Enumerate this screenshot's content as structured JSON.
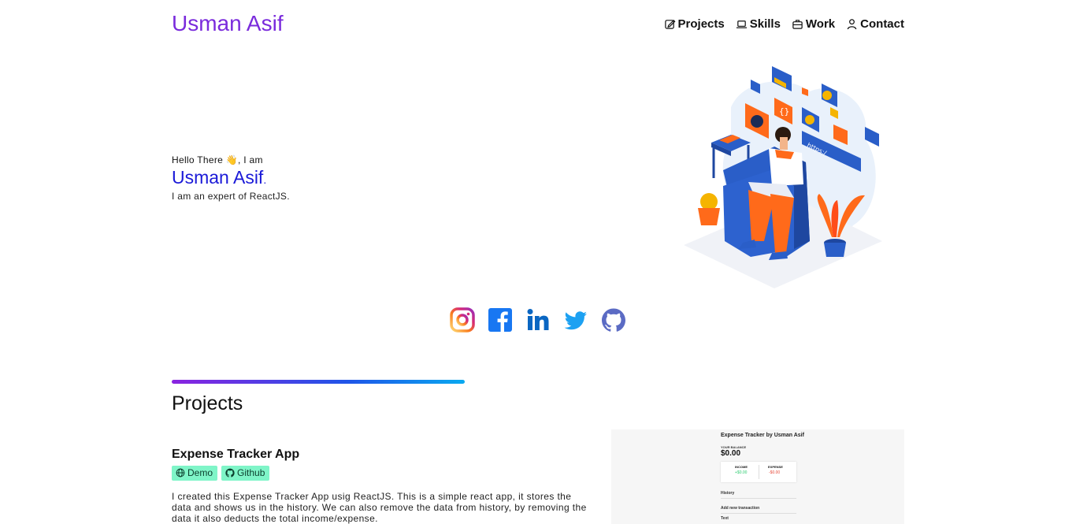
{
  "header": {
    "brand": "Usman Asif",
    "nav": [
      {
        "label": "Projects",
        "icon": "pencil-square-icon"
      },
      {
        "label": "Skills",
        "icon": "laptop-icon"
      },
      {
        "label": "Work",
        "icon": "briefcase-icon"
      },
      {
        "label": "Contact",
        "icon": "person-icon"
      }
    ]
  },
  "hero": {
    "greeting": "Hello There 👋, I am",
    "name": "Usman Asif",
    "name_suffix": ".",
    "tagline": "I am an expert of ReactJS."
  },
  "socials": [
    {
      "name": "instagram",
      "icon": "instagram-icon"
    },
    {
      "name": "facebook",
      "icon": "facebook-icon"
    },
    {
      "name": "linkedin",
      "icon": "linkedin-icon"
    },
    {
      "name": "twitter",
      "icon": "twitter-icon"
    },
    {
      "name": "github",
      "icon": "github-icon"
    }
  ],
  "projects": {
    "title": "Projects",
    "items": [
      {
        "title": "Expense Tracker App",
        "demo_label": "Demo",
        "github_label": "Github",
        "description": "I created this Expense Tracker App usig ReactJS. This is a simple react app, it stores the data and shows us in the history. We can also remove the data from history, by removing the data it also deducts the total income/expense.",
        "preview": {
          "title": "Expense Tracker by Usman Asif",
          "balance_label": "YOUR BALANCE",
          "balance_value": "$0.00",
          "income_label": "INCOME",
          "income_value": "+$0.00",
          "expense_label": "EXPENSE",
          "expense_value": "-$0.00",
          "history_label": "History",
          "add_label": "Add new transaction",
          "text_label": "Text"
        }
      }
    ]
  },
  "colors": {
    "brand": "#7a2bdc",
    "name": "#1a19d8",
    "tag_bg": "#7ff5c8",
    "divider_start": "#8a23e0",
    "divider_end": "#09a9f0"
  }
}
